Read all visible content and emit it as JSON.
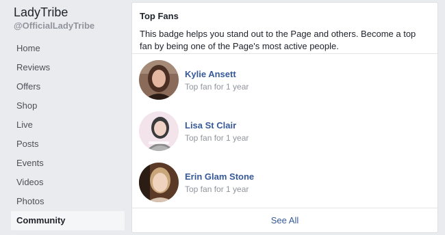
{
  "page": {
    "name": "LadyTribe",
    "handle": "@OfficialLadyTribe"
  },
  "nav": {
    "items": [
      {
        "label": "Home"
      },
      {
        "label": "Reviews"
      },
      {
        "label": "Offers"
      },
      {
        "label": "Shop"
      },
      {
        "label": "Live"
      },
      {
        "label": "Posts"
      },
      {
        "label": "Events"
      },
      {
        "label": "Videos"
      },
      {
        "label": "Photos"
      },
      {
        "label": "Community",
        "active": true
      }
    ]
  },
  "top_fans": {
    "title": "Top Fans",
    "description": "This badge helps you stand out to the Page and others. Become a top fan by being one of the Page's most active people.",
    "fans": [
      {
        "name": "Kylie Ansett",
        "meta": "Top fan for 1 year"
      },
      {
        "name": "Lisa St Clair",
        "meta": "Top fan for 1 year"
      },
      {
        "name": "Erin Glam Stone",
        "meta": "Top fan for 1 year"
      }
    ],
    "see_all_label": "See All"
  },
  "colors": {
    "link": "#365899",
    "muted": "#90949c",
    "background": "#e9ebee"
  }
}
